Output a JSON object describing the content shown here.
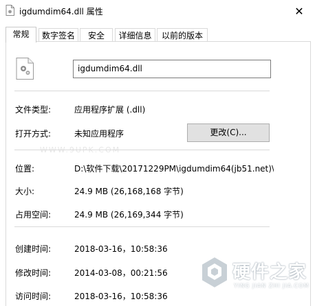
{
  "window": {
    "title": "igdumdim64.dll 属性",
    "close_glyph": "✕"
  },
  "tabs": [
    {
      "label": "常规",
      "active": true
    },
    {
      "label": "数字签名",
      "active": false
    },
    {
      "label": "安全",
      "active": false
    },
    {
      "label": "详细信息",
      "active": false
    },
    {
      "label": "以前的版本",
      "active": false
    }
  ],
  "general": {
    "file_name": "igdumdim64.dll",
    "file_type": {
      "label": "文件类型:",
      "value": "应用程序扩展 (.dll)"
    },
    "opens_with": {
      "label": "打开方式:",
      "value": "未知应用程序",
      "button": "更改(C)..."
    },
    "location": {
      "label": "位置:",
      "value": "D:\\软件下载\\20171229PM\\igdumdim64(jb51.net)\\"
    },
    "size": {
      "label": "大小:",
      "value": "24.9 MB (26,168,168 字节)"
    },
    "size_on_disk": {
      "label": "占用空间:",
      "value": "24.9 MB (26,169,344 字节)"
    },
    "created": {
      "label": "创建时间:",
      "value": "2018-03-16，10:58:36"
    },
    "modified": {
      "label": "修改时间:",
      "value": "2014-03-08，00:21:56"
    },
    "accessed": {
      "label": "访问时间:",
      "value": "2018-03-16，10:58:36"
    }
  },
  "watermark": {
    "text": "WWW.9UPK.COM"
  },
  "brand": {
    "name": "硬件之家",
    "sub": "YING JIAN ZHI JIA.COM"
  },
  "icons": {
    "file": "dll-gear-file-icon",
    "brand": "hexagon-logo-icon"
  }
}
